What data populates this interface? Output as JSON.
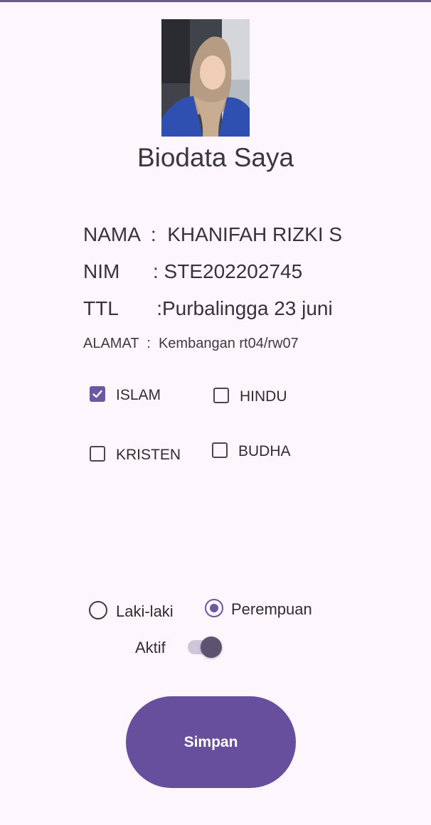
{
  "header": {
    "title": "Biodata Saya"
  },
  "profile": {
    "nama": "NAMA  :  KHANIFAH RIZKI S",
    "nim": "NIM      : STE202202745",
    "ttl": "TTL       :Purbalingga 23 juni",
    "alamat": "ALAMAT  :  Kembangan rt04/rw07"
  },
  "religion": {
    "options": [
      {
        "label": "ISLAM",
        "checked": true
      },
      {
        "label": "HINDU",
        "checked": false
      },
      {
        "label": "KRISTEN",
        "checked": false
      },
      {
        "label": "BUDHA",
        "checked": false
      }
    ]
  },
  "gender": {
    "options": [
      {
        "label": "Laki-laki",
        "selected": false
      },
      {
        "label": "Perempuan",
        "selected": true
      }
    ]
  },
  "status": {
    "label": "Aktif",
    "on": true
  },
  "actions": {
    "save_label": "Simpan"
  },
  "colors": {
    "accent": "#684f9e",
    "background": "#fdf7fd"
  }
}
